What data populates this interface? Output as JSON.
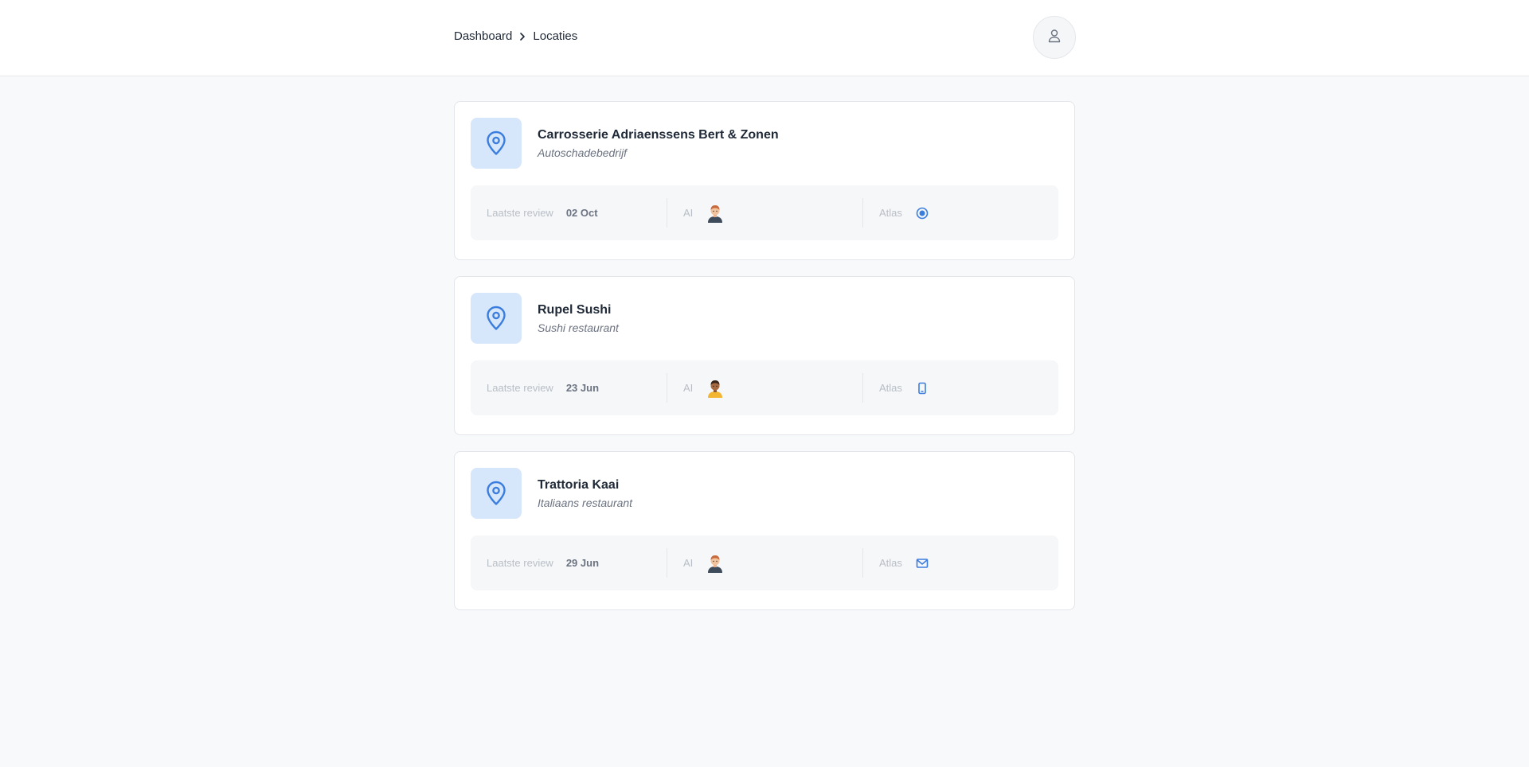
{
  "header": {
    "breadcrumb": {
      "home": "Dashboard",
      "current": "Locaties"
    },
    "user_icon": "user-icon"
  },
  "colors": {
    "accent": "#3b7ddd",
    "icon_bg": "#d6e6fb"
  },
  "locations": [
    {
      "name": "Carrosserie Adriaenssens Bert & Zonen",
      "category": "Autoschadebedrijf",
      "last_review_label": "Laatste review",
      "last_review_value": "02 Oct",
      "ai_label": "AI",
      "ai_avatar": "man-avatar-icon",
      "atlas_label": "Atlas",
      "atlas_icon": "radio-dot-icon"
    },
    {
      "name": "Rupel Sushi",
      "category": "Sushi restaurant",
      "last_review_label": "Laatste review",
      "last_review_value": "23 Jun",
      "ai_label": "AI",
      "ai_avatar": "man-avatar-dark-icon",
      "atlas_label": "Atlas",
      "atlas_icon": "smartphone-icon"
    },
    {
      "name": "Trattoria Kaai",
      "category": "Italiaans restaurant",
      "last_review_label": "Laatste review",
      "last_review_value": "29 Jun",
      "ai_label": "AI",
      "ai_avatar": "man-avatar-icon",
      "atlas_label": "Atlas",
      "atlas_icon": "mail-icon"
    }
  ]
}
